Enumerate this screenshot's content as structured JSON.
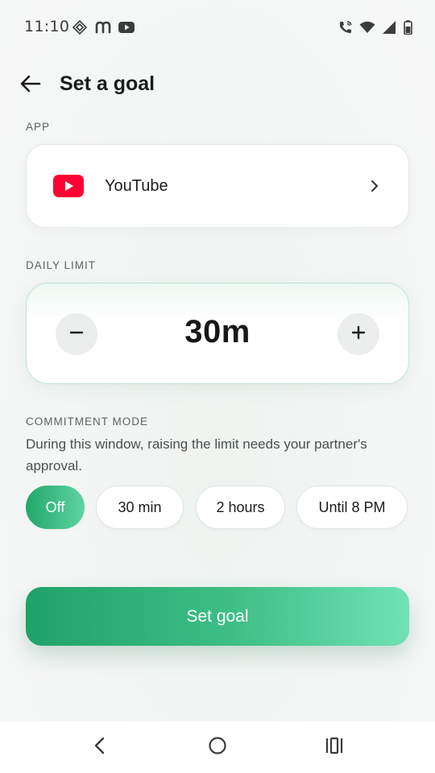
{
  "status_bar": {
    "time": "11:10",
    "left_icons": [
      "diamond-grid-icon",
      "m-app-icon",
      "youtube-notification-icon"
    ],
    "right_icons": [
      "wifi-call-icon",
      "wifi-icon",
      "signal-icon",
      "battery-icon"
    ]
  },
  "header": {
    "title": "Set a goal"
  },
  "app_section": {
    "label": "APP",
    "app_name": "YouTube",
    "app_icon": "youtube-icon",
    "brand_color": "#ff0033"
  },
  "limit_section": {
    "label": "DAILY LIMIT",
    "value": "30m"
  },
  "commitment_section": {
    "label": "COMMITMENT MODE",
    "description": "During this window, raising the limit needs your partner's approval.",
    "options": [
      {
        "label": "Off",
        "selected": true
      },
      {
        "label": "30 min",
        "selected": false
      },
      {
        "label": "2 hours",
        "selected": false
      },
      {
        "label": "Until 8 PM",
        "selected": false
      }
    ]
  },
  "cta": {
    "label": "Set goal"
  },
  "colors": {
    "accent": "#22a86a",
    "accent_light": "#6fe0b4"
  }
}
